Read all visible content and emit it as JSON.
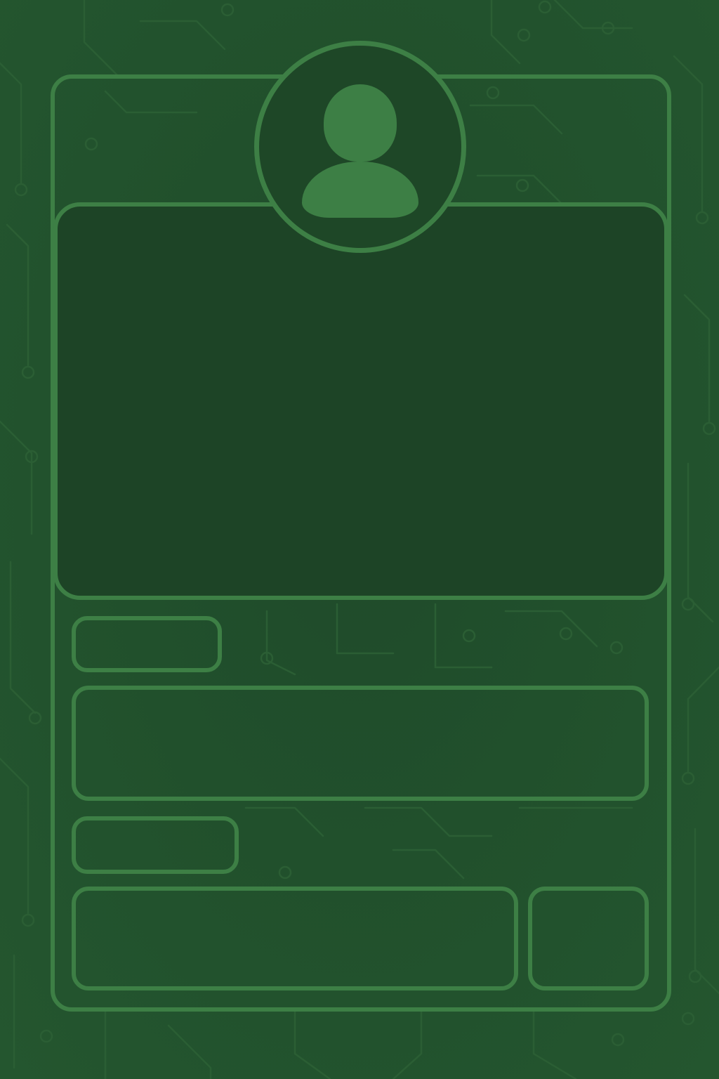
{
  "theme": {
    "background": "#21502c",
    "panel": "#1d4426",
    "outline": "#3d7f45",
    "circuit_line": "#2b5e34"
  },
  "profile_card": {
    "avatar_icon": "user-icon",
    "media_placeholder": "",
    "field_label_1": "",
    "text_content": "",
    "field_label_2": "",
    "input_value": "",
    "input_placeholder": "",
    "action_label": ""
  }
}
